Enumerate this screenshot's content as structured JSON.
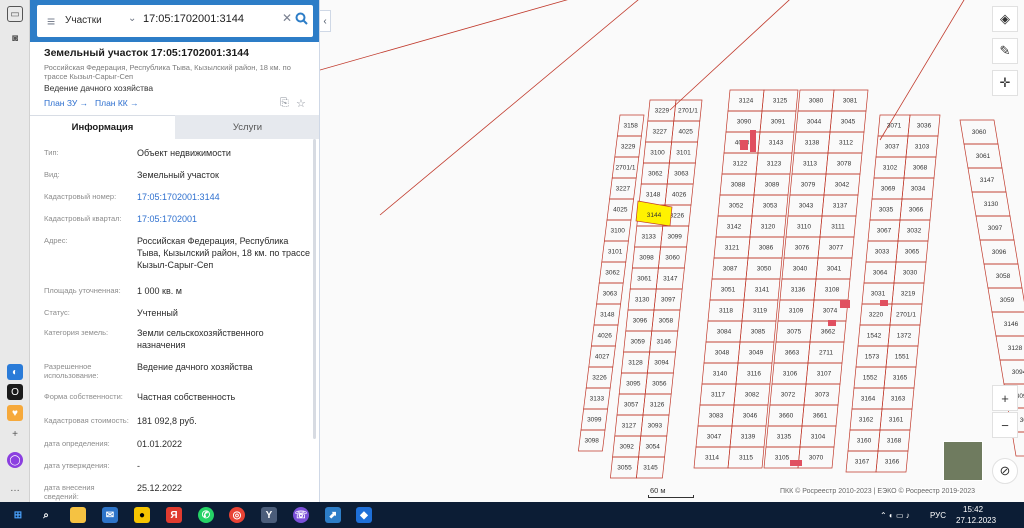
{
  "search": {
    "scope": "Участки",
    "query": "17:05:1702001:3144"
  },
  "parcel": {
    "title": "Земельный участок 17:05:1702001:3144",
    "address": "Российская Федерация, Республика Тыва, Кызылский район, 18 км. по трассе Кызыл-Сарыг-Сеп",
    "use": "Ведение дачного хозяйства",
    "plan_zu": "План ЗУ →",
    "plan_kk": "План КК →"
  },
  "tabs": {
    "info": "Информация",
    "services": "Услуги"
  },
  "attributes": [
    {
      "label": "Тип:",
      "value": "Объект недвижимости"
    },
    {
      "label": "Вид:",
      "value": "Земельный участок"
    },
    {
      "label": "Кадастровый номер:",
      "value": "17:05:1702001:3144"
    },
    {
      "label": "Кадастровый квартал:",
      "value": "17:05:1702001"
    },
    {
      "label": "Адрес:",
      "value": "Российская Федерация, Республика Тыва, Кызылский район, 18 км. по трассе Кызыл-Сарыг-Сеп"
    },
    {
      "label": "Площадь уточненная:",
      "value": "1 000 кв. м"
    },
    {
      "label": "Статус:",
      "value": "Учтенный"
    },
    {
      "label": "Категория земель:",
      "value": "Земли сельскохозяйственного назначения"
    },
    {
      "label": "Разрешенное использование:",
      "value": "Ведение дачного хозяйства"
    },
    {
      "label": "Форма собственности:",
      "value": "Частная собственность"
    },
    {
      "label": "Кадастровая стоимость:",
      "value": "181 092,8 руб."
    },
    {
      "label": "дата определения:",
      "value": "01.01.2022"
    },
    {
      "label": "дата утверждения:",
      "value": "-"
    },
    {
      "label": "дата внесения сведений:",
      "value": "25.12.2022"
    }
  ],
  "map": {
    "scale": "60 м",
    "copyright": "ПКК © Росреестр 2010-2023 | ЕЭКО © Росреестр 2019-2023",
    "selected_parcel": "3144",
    "colors": {
      "parcel_line": "#c0392b",
      "selected_fill": "#fff200",
      "building": "#e05060"
    },
    "parcel_labels": [
      "3229",
      "2701/1",
      "3227",
      "4025",
      "3100",
      "3101",
      "3062",
      "3063",
      "3148",
      "4026",
      "4027",
      "3226",
      "3133",
      "3099",
      "3098",
      "3060",
      "3061",
      "3147",
      "3130",
      "3097",
      "3096",
      "3058",
      "3059",
      "3146",
      "3128",
      "3094",
      "3095",
      "3056",
      "3057",
      "3126",
      "3127",
      "3093",
      "3092",
      "3054",
      "3055",
      "3145",
      "3124",
      "3125",
      "3090",
      "3091",
      "4048",
      "3143",
      "3122",
      "3123",
      "3088",
      "3089",
      "3052",
      "3053",
      "3142",
      "3120",
      "3121",
      "3086",
      "3087",
      "3050",
      "3051",
      "3141",
      "3118",
      "3119",
      "3084",
      "3085",
      "3048",
      "3049",
      "3140",
      "3116",
      "3117",
      "3082",
      "3083",
      "3046",
      "3047",
      "3139",
      "3114",
      "3115",
      "3080",
      "3081",
      "3044",
      "3045",
      "3138",
      "3112",
      "3113",
      "3078",
      "3079",
      "3042",
      "3043",
      "3137",
      "3110",
      "3111",
      "3076",
      "3077",
      "3040",
      "3041",
      "3136",
      "3108",
      "3109",
      "3074",
      "3075",
      "3662",
      "3663",
      "2711",
      "3106",
      "3107",
      "3072",
      "3073",
      "3660",
      "3661",
      "3135",
      "3104",
      "3105",
      "3070",
      "3071",
      "3036",
      "3037",
      "3103",
      "3102",
      "3068",
      "3069",
      "3034",
      "3035",
      "3066",
      "3067",
      "3032",
      "3033",
      "3065",
      "3064",
      "3030",
      "3031",
      "3219",
      "3220",
      "2701/1",
      "1542",
      "1372",
      "1573",
      "1551",
      "1552",
      "3165",
      "3164",
      "3163",
      "3162",
      "3161",
      "3160",
      "3168",
      "3167",
      "3166",
      "3158"
    ]
  },
  "taskbar": {
    "time": "15:42",
    "date": "27.12.2023",
    "lang": "РУС"
  }
}
